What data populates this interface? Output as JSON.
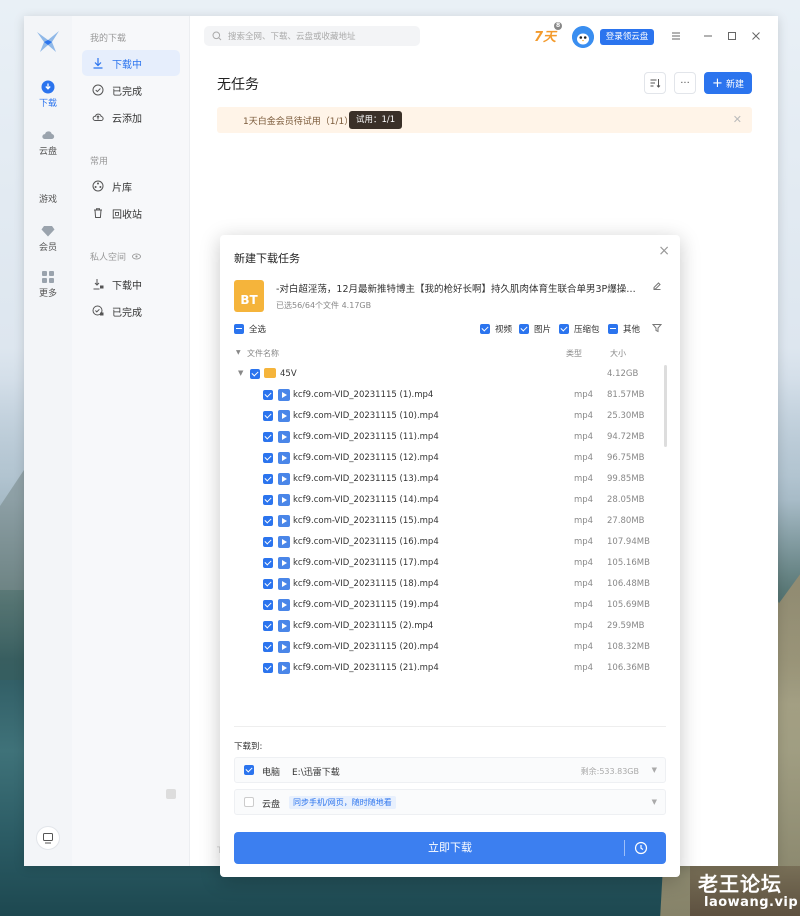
{
  "rail": {
    "items": [
      {
        "label": "下载",
        "active": true
      },
      {
        "label": "云盘"
      },
      {
        "label": "游戏"
      },
      {
        "label": "会员"
      },
      {
        "label": "更多"
      }
    ]
  },
  "sidebar": {
    "group_my": "我的下载",
    "downloading": "下载中",
    "completed": "已完成",
    "cloud_add": "云添加",
    "group_common": "常用",
    "library": "片库",
    "trash": "回收站",
    "group_private": "私人空间",
    "private_downloading": "下载中",
    "private_completed": "已完成"
  },
  "header": {
    "search_placeholder": "搜索全网、下载、云盘或收藏地址",
    "vip_badge": "7天",
    "vip_badge_dot": "8",
    "login_button": "登录领云盘"
  },
  "main": {
    "title": "无任务",
    "new_button": "新建",
    "more_button": "···",
    "trial_text": "1天白金会员待试用（1/1）",
    "trial_pill": "试用：1/1",
    "ghost_text": "T"
  },
  "modal": {
    "title": "新建下载任务",
    "close": "×",
    "bt_label": "BT",
    "task_name": "-对白超淫荡，12月最新推特博主【我的枪好长啊】持久肌肉体育生联合单男3P爆操羞辱...",
    "task_sub": "已选56/64个文件 4.17GB",
    "select_all": "全选",
    "filters": [
      {
        "label": "视频",
        "checked": true
      },
      {
        "label": "图片",
        "checked": true
      },
      {
        "label": "压缩包",
        "checked": true
      },
      {
        "label": "其他",
        "checked": false
      }
    ],
    "columns": {
      "name": "文件名称",
      "type": "类型",
      "size": "大小"
    },
    "folder": {
      "name": "45V",
      "size": "4.12GB"
    },
    "files": [
      {
        "name": "kcf9.com-VID_20231115 (1).mp4",
        "type": "mp4",
        "size": "81.57MB"
      },
      {
        "name": "kcf9.com-VID_20231115 (10).mp4",
        "type": "mp4",
        "size": "25.30MB"
      },
      {
        "name": "kcf9.com-VID_20231115 (11).mp4",
        "type": "mp4",
        "size": "94.72MB"
      },
      {
        "name": "kcf9.com-VID_20231115 (12).mp4",
        "type": "mp4",
        "size": "96.75MB"
      },
      {
        "name": "kcf9.com-VID_20231115 (13).mp4",
        "type": "mp4",
        "size": "99.85MB"
      },
      {
        "name": "kcf9.com-VID_20231115 (14).mp4",
        "type": "mp4",
        "size": "28.05MB"
      },
      {
        "name": "kcf9.com-VID_20231115 (15).mp4",
        "type": "mp4",
        "size": "27.80MB"
      },
      {
        "name": "kcf9.com-VID_20231115 (16).mp4",
        "type": "mp4",
        "size": "107.94MB"
      },
      {
        "name": "kcf9.com-VID_20231115 (17).mp4",
        "type": "mp4",
        "size": "105.16MB"
      },
      {
        "name": "kcf9.com-VID_20231115 (18).mp4",
        "type": "mp4",
        "size": "106.48MB"
      },
      {
        "name": "kcf9.com-VID_20231115 (19).mp4",
        "type": "mp4",
        "size": "105.69MB"
      },
      {
        "name": "kcf9.com-VID_20231115 (2).mp4",
        "type": "mp4",
        "size": "29.59MB"
      },
      {
        "name": "kcf9.com-VID_20231115 (20).mp4",
        "type": "mp4",
        "size": "108.32MB"
      },
      {
        "name": "kcf9.com-VID_20231115 (21).mp4",
        "type": "mp4",
        "size": "106.36MB"
      }
    ],
    "download_to": "下载到:",
    "dest_pc": {
      "label": "电脑",
      "path": "E:\\迅雷下载",
      "free": "剩余:533.83GB"
    },
    "dest_cloud": {
      "label": "云盘",
      "tag": "同步手机/网页，随时随地看"
    },
    "go_button": "立即下载"
  },
  "watermark": {
    "main": "老王论坛",
    "sub": "laowang.vip"
  },
  "colors": {
    "accent": "#2b74ee",
    "bt": "#f5b43b",
    "trial_bg": "#fff4e8"
  }
}
